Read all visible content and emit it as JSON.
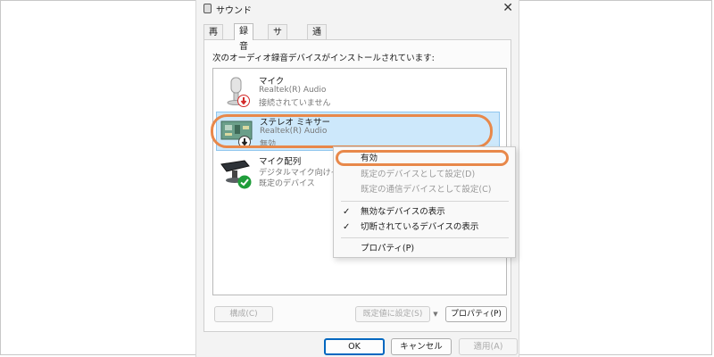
{
  "window": {
    "title": "サウンド",
    "close_glyph": "✕"
  },
  "tabs": [
    {
      "label": "再生",
      "active": false
    },
    {
      "label": "録音",
      "active": true
    },
    {
      "label": "サウンド",
      "active": false
    },
    {
      "label": "通信",
      "active": false
    }
  ],
  "instruction": "次のオーディオ録音デバイスがインストールされています:",
  "devices": [
    {
      "name": "マイク",
      "line1": "Realtek(R) Audio",
      "line2": "接続されていません",
      "icon": "microphone-icon",
      "status_icon": "disconnected-red-arrow-icon",
      "selected": false
    },
    {
      "name": "ステレオ ミキサー",
      "line1": "Realtek(R) Audio",
      "line2": "無効",
      "icon": "circuit-board-icon",
      "status_icon": "disabled-down-arrow-icon",
      "selected": true
    },
    {
      "name": "マイク配列",
      "line1": "デジタルマイク向けインテル",
      "line2": "既定のデバイス",
      "icon": "webcam-icon",
      "status_icon": "default-green-check-icon",
      "selected": false
    }
  ],
  "panel_buttons": {
    "configure": "構成(C)",
    "set_default": "既定値に設定(S)",
    "properties": "プロパティ(P)"
  },
  "footer_buttons": {
    "ok": "OK",
    "cancel": "キャンセル",
    "apply": "適用(A)"
  },
  "context_menu": {
    "items": [
      {
        "label": "有効",
        "enabled": true,
        "checked": false
      },
      {
        "label": "既定のデバイスとして設定(D)",
        "enabled": false,
        "checked": false
      },
      {
        "label": "既定の通信デバイスとして設定(C)",
        "enabled": false,
        "checked": false
      },
      {
        "label": "無効なデバイスの表示",
        "enabled": true,
        "checked": true
      },
      {
        "label": "切断されているデバイスの表示",
        "enabled": true,
        "checked": true
      },
      {
        "label": "プロパティ(P)",
        "enabled": true,
        "checked": false
      }
    ],
    "check_glyph": "✓"
  },
  "colors": {
    "highlight_ring": "#e8884a",
    "selection": "#cde8fb",
    "default_button": "#0067c0",
    "check_green": "#1f9d3a",
    "disconnected_red": "#d32a2a"
  }
}
